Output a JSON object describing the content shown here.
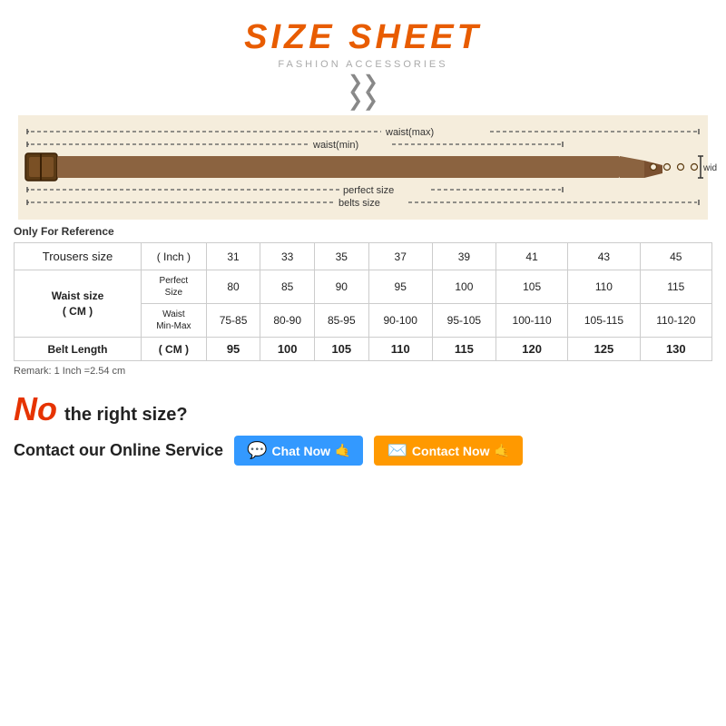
{
  "header": {
    "title": "SIZE SHEET",
    "subtitle": "FASHION ACCESSORIES"
  },
  "belt_diagram": {
    "labels": {
      "waist_max": "waist(max)",
      "waist_min": "waist(min)",
      "perfect_size": "perfect size",
      "belts_size": "belts size",
      "width": "width"
    }
  },
  "only_ref": "Only For Reference",
  "table": {
    "headers": [
      "Trousers size",
      "( Inch )",
      "31",
      "33",
      "35",
      "37",
      "39",
      "41",
      "43",
      "45"
    ],
    "waist_label": "Waist size\n( CM )",
    "perfect_size_label": "Perfect\nSize",
    "waist_min_max_label": "Waist\nMin-Max",
    "rows": {
      "perfect": [
        "80",
        "85",
        "90",
        "95",
        "100",
        "105",
        "110",
        "115"
      ],
      "waist_range": [
        "75-85",
        "80-90",
        "85-95",
        "90-100",
        "95-105",
        "100-110",
        "105-115",
        "110-120"
      ],
      "belt_length_label": "Belt Length",
      "belt_length_unit": "( CM )",
      "belt_length": [
        "95",
        "100",
        "105",
        "110",
        "115",
        "120",
        "125",
        "130"
      ]
    }
  },
  "remark": "Remark: 1 Inch =2.54 cm",
  "no_size": {
    "no_text": "No",
    "right_size_text": "the right size?",
    "contact_label": "Contact our Online Service",
    "chat_btn": "Chat Now",
    "contact_btn": "Contact Now"
  }
}
